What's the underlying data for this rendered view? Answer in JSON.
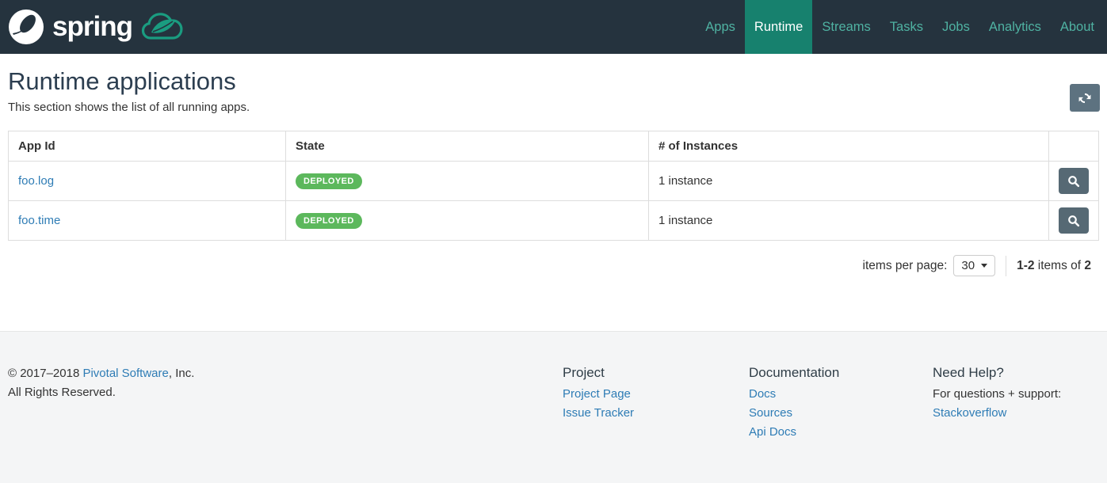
{
  "colors": {
    "navbar_bg": "#25333e",
    "active_tab": "#17816e",
    "nav_link": "#4fb2a2",
    "link_blue": "#2e7cb5",
    "badge_green": "#5cb85c",
    "button_slate": "#5d7280",
    "button_slate_dark": "#566974"
  },
  "navbar": {
    "brand_word": "spring",
    "items": [
      {
        "label": "Apps"
      },
      {
        "label": "Runtime"
      },
      {
        "label": "Streams"
      },
      {
        "label": "Tasks"
      },
      {
        "label": "Jobs"
      },
      {
        "label": "Analytics"
      },
      {
        "label": "About"
      }
    ],
    "active_item": "Runtime"
  },
  "page": {
    "title": "Runtime applications",
    "subtitle": "This section shows the list of all running apps."
  },
  "table": {
    "headers": [
      "App Id",
      "State",
      "# of Instances"
    ],
    "rows": [
      {
        "app_id": "foo.log",
        "state": "DEPLOYED",
        "instances": "1 instance"
      },
      {
        "app_id": "foo.time",
        "state": "DEPLOYED",
        "instances": "1 instance"
      }
    ]
  },
  "pagination": {
    "items_per_page_label": "items per page:",
    "items_per_page_value": "30",
    "range": "1-2",
    "middle": " items of ",
    "total": "2"
  },
  "footer": {
    "copyright_prefix": "© 2017–2018 ",
    "copyright_link": "Pivotal Software",
    "copyright_suffix": ", Inc.",
    "rights": "All Rights Reserved.",
    "columns": [
      {
        "heading": "Project",
        "links": [
          "Project Page",
          "Issue Tracker"
        ]
      },
      {
        "heading": "Documentation",
        "links": [
          "Docs",
          "Sources",
          "Api Docs"
        ]
      },
      {
        "heading": "Need Help?",
        "text": "For questions + support:",
        "links": [
          "Stackoverflow"
        ]
      }
    ]
  }
}
